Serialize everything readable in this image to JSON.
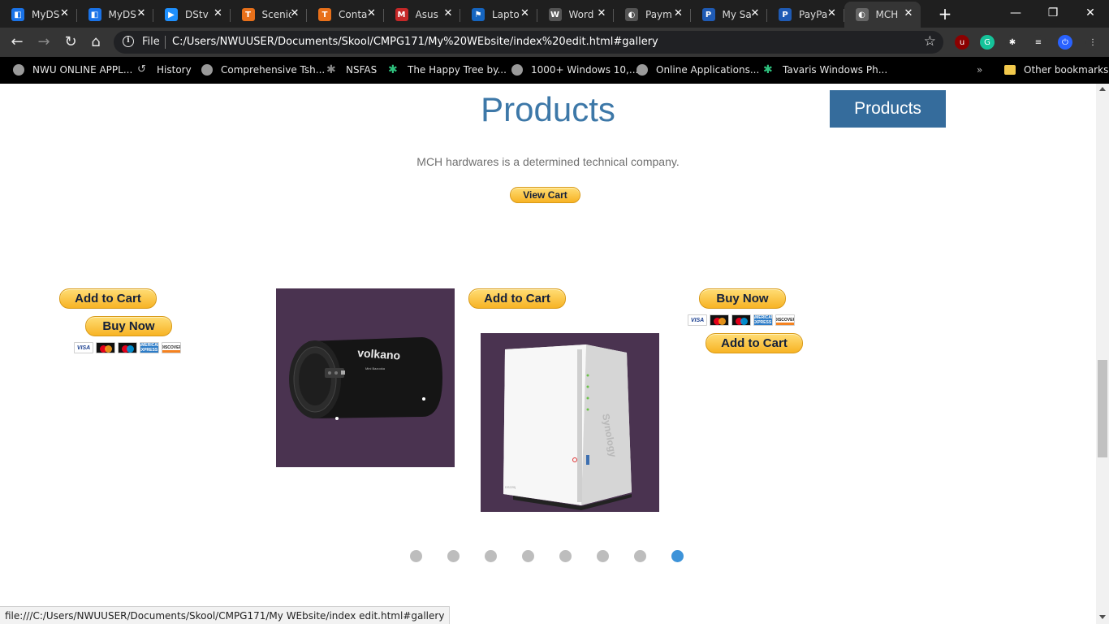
{
  "browser": {
    "tabs": [
      {
        "title": "MyDS",
        "favicon_color": "#1a73e8",
        "favicon_glyph": "◧",
        "active": false
      },
      {
        "title": "MyDS",
        "favicon_color": "#1a73e8",
        "favicon_glyph": "◧",
        "active": false
      },
      {
        "title": "DStv",
        "favicon_color": "#1e90ff",
        "favicon_glyph": "▶",
        "active": false
      },
      {
        "title": "Scenic",
        "favicon_color": "#e8701a",
        "favicon_glyph": "T",
        "active": false
      },
      {
        "title": "Conta",
        "favicon_color": "#e8701a",
        "favicon_glyph": "T",
        "active": false
      },
      {
        "title": "Asus",
        "favicon_color": "#c62828",
        "favicon_glyph": "M",
        "active": false
      },
      {
        "title": "Lapto",
        "favicon_color": "#1565c0",
        "favicon_glyph": "⚑",
        "active": false
      },
      {
        "title": "Word",
        "favicon_color": "#555555",
        "favicon_glyph": "W",
        "active": false
      },
      {
        "title": "Paym",
        "favicon_color": "#555555",
        "favicon_glyph": "◐",
        "active": false
      },
      {
        "title": "My Sa",
        "favicon_color": "#1f5bb5",
        "favicon_glyph": "P",
        "active": false
      },
      {
        "title": "PayPa",
        "favicon_color": "#1f5bb5",
        "favicon_glyph": "P",
        "active": false
      },
      {
        "title": "MCH",
        "favicon_color": "#666666",
        "favicon_glyph": "◐",
        "active": true
      }
    ],
    "new_tab_glyph": "+",
    "window_controls": {
      "minimize": "—",
      "restore": "❐",
      "close": "✕"
    },
    "nav": {
      "back": "←",
      "forward": "→",
      "reload": "↻",
      "home": "⌂"
    },
    "omnibox": {
      "info_glyph": "i",
      "scheme_label": "File",
      "url": "C:/Users/NWUUSER/Documents/Skool/CMPG171/My%20WEbsite/index%20edit.html#gallery",
      "star_glyph": "☆"
    },
    "extensions": [
      {
        "name": "ublock-icon",
        "color": "#8b0000",
        "glyph": "u"
      },
      {
        "name": "grammarly-icon",
        "color": "#15c39a",
        "glyph": "G"
      },
      {
        "name": "puzzle-icon",
        "color": "#353535",
        "glyph": "✱"
      },
      {
        "name": "media-icon",
        "color": "#353535",
        "glyph": "≡"
      },
      {
        "name": "power-icon",
        "color": "#2962ff",
        "glyph": "⏻"
      },
      {
        "name": "menu-icon",
        "color": "#353535",
        "glyph": "⋮"
      }
    ],
    "bookmarks": [
      {
        "label": "NWU ONLINE APPL...",
        "icon": "globe"
      },
      {
        "label": "History",
        "icon": "history"
      },
      {
        "label": "Comprehensive Tsh...",
        "icon": "globe"
      },
      {
        "label": "NSFAS",
        "icon": "leaf-gray"
      },
      {
        "label": "The Happy Tree by...",
        "icon": "leaf"
      },
      {
        "label": "1000+ Windows 10,...",
        "icon": "globe"
      },
      {
        "label": "Online Applications...",
        "icon": "globe"
      },
      {
        "label": "Tavaris Windows Ph...",
        "icon": "leaf"
      }
    ],
    "bookmarks_overflow": "»",
    "other_bookmarks": "Other bookmarks",
    "status_url": "file:///C:/Users/NWUUSER/Documents/Skool/CMPG171/My WEbsite/index edit.html#gallery"
  },
  "page": {
    "heading": "Products",
    "nav_button": "Products",
    "tagline": "MCH hardwares is a determined technical company.",
    "view_cart": "View Cart",
    "add_to_cart": "Add to Cart",
    "buy_now": "Buy Now",
    "card_labels": {
      "visa": "VISA",
      "amex": "AMERICAN EXPRESS",
      "discover": "DISCOVER"
    },
    "products": [
      {
        "name": "speaker",
        "brand_text": "volkano",
        "model_text": "Mini Bazooka"
      },
      {
        "name": "nas",
        "brand_text": "Synology",
        "model_text": "DS220j"
      }
    ],
    "carousel": {
      "count": 8,
      "active_index": 7,
      "active_color": "#3d93d9",
      "inactive_color": "#bdbdbd"
    }
  }
}
